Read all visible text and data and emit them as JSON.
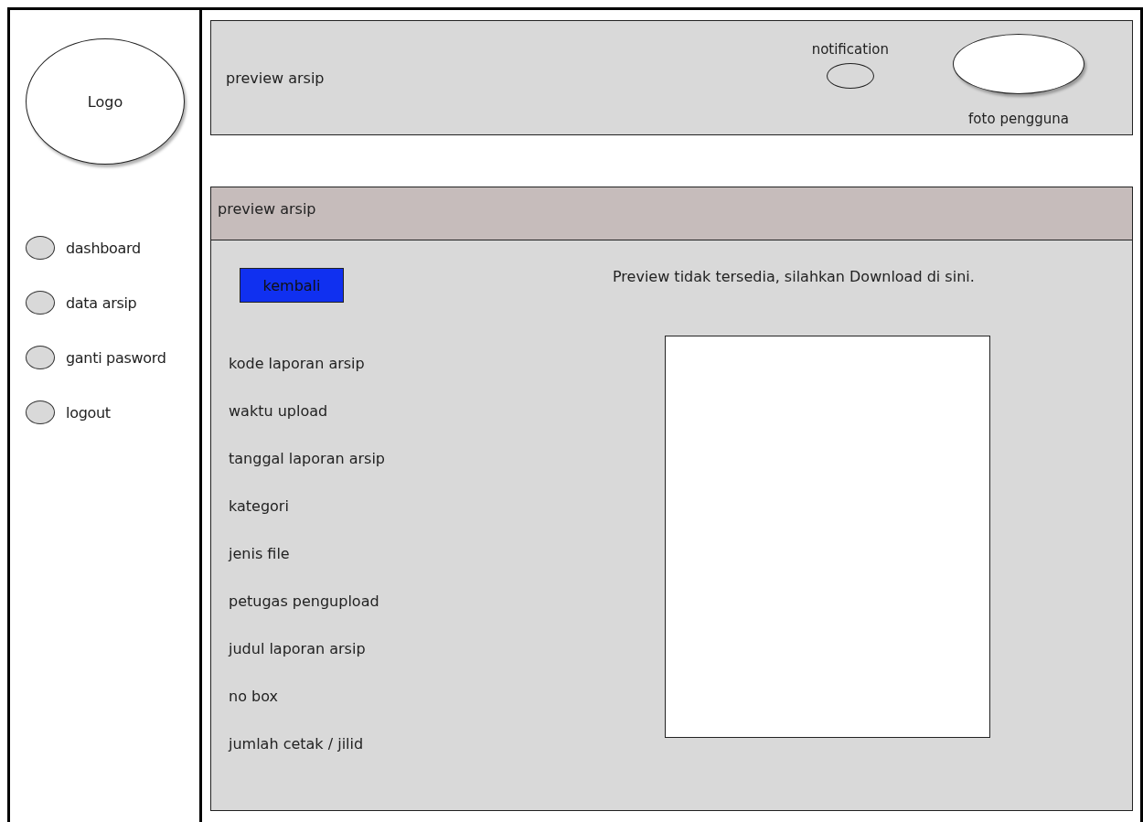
{
  "sidebar": {
    "logo": "Logo",
    "items": [
      {
        "label": "dashboard"
      },
      {
        "label": "data arsip"
      },
      {
        "label": "ganti pasword"
      },
      {
        "label": "logout"
      }
    ]
  },
  "header": {
    "title": "preview arsip",
    "notification": "notification",
    "user_photo": "foto pengguna"
  },
  "panel": {
    "title": "preview arsip",
    "back_button": "kembali",
    "message": "Preview tidak tersedia, silahkan Download di sini.",
    "fields": [
      "kode laporan arsip",
      "waktu upload",
      "tanggal laporan arsip",
      "kategori",
      "jenis file",
      "petugas pengupload",
      "judul laporan arsip",
      "no box",
      "jumlah cetak / jilid"
    ]
  }
}
